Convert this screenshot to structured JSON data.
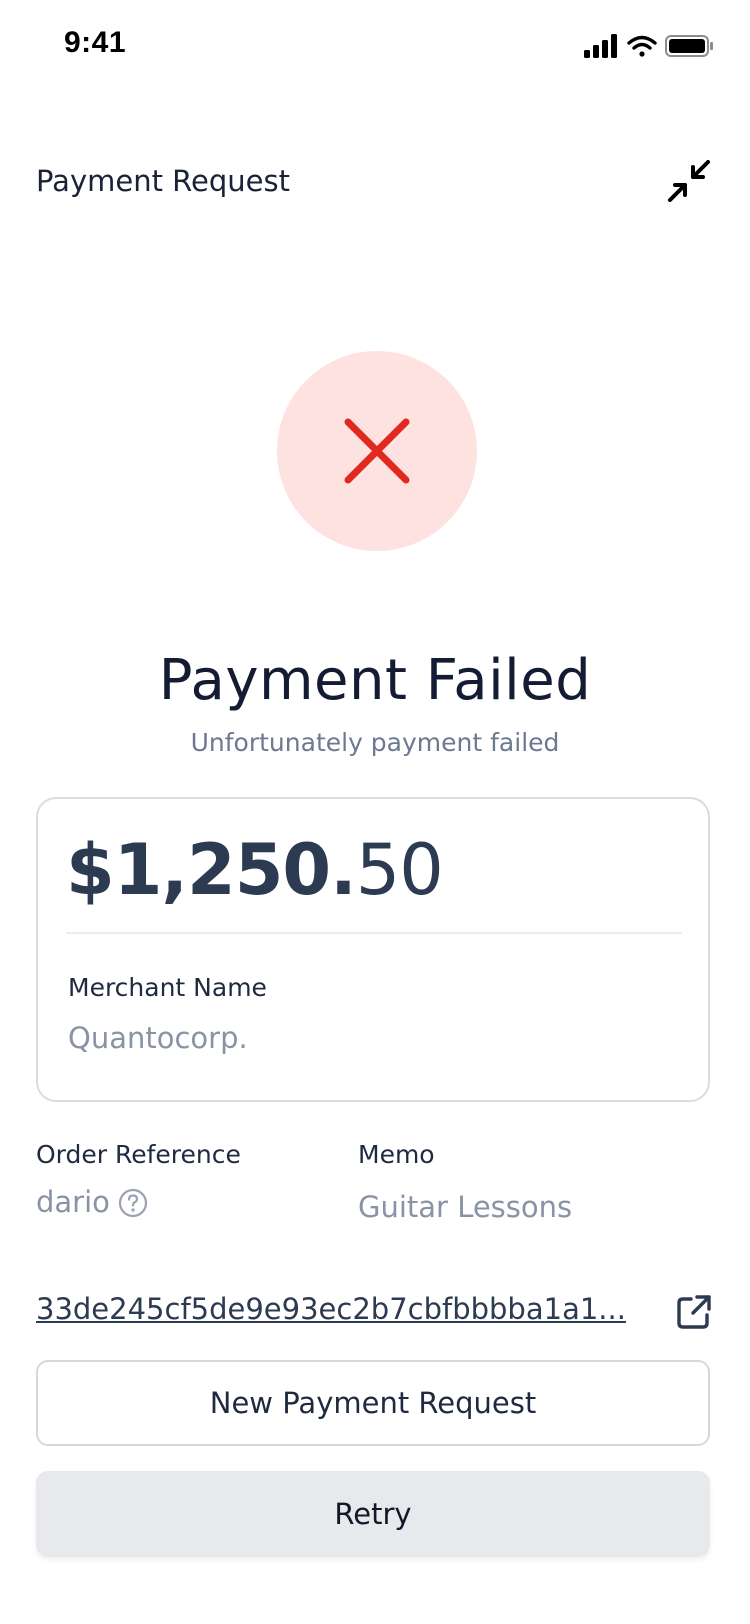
{
  "status_bar": {
    "time": "9:41",
    "icons": [
      "cellular-signal-icon",
      "wifi-icon",
      "battery-icon"
    ]
  },
  "header": {
    "title": "Payment Request",
    "collapse_icon": "collapse-arrows-icon"
  },
  "status": {
    "icon": "x-mark-icon",
    "title": "Payment Failed",
    "subtitle": "Unfortunately payment failed"
  },
  "amount": {
    "major": "$1,250.",
    "minor": "50"
  },
  "merchant": {
    "label": "Merchant Name",
    "value": "Quantocorp."
  },
  "order": {
    "label": "Order Reference",
    "value": "dario",
    "help_icon": "question-circle-icon"
  },
  "memo": {
    "label": "Memo",
    "value": "Guitar Lessons"
  },
  "transaction": {
    "hash": "33de245cf5de9e93ec2b7cbfbbbba1a1...",
    "link_icon": "external-link-icon"
  },
  "actions": {
    "new_request_label": "New Payment Request",
    "retry_label": "Retry"
  },
  "colors": {
    "error_red": "#e02a1f",
    "error_bg": "#fde2e0",
    "text_dark": "#141c33",
    "text_muted": "#8a93a6"
  }
}
